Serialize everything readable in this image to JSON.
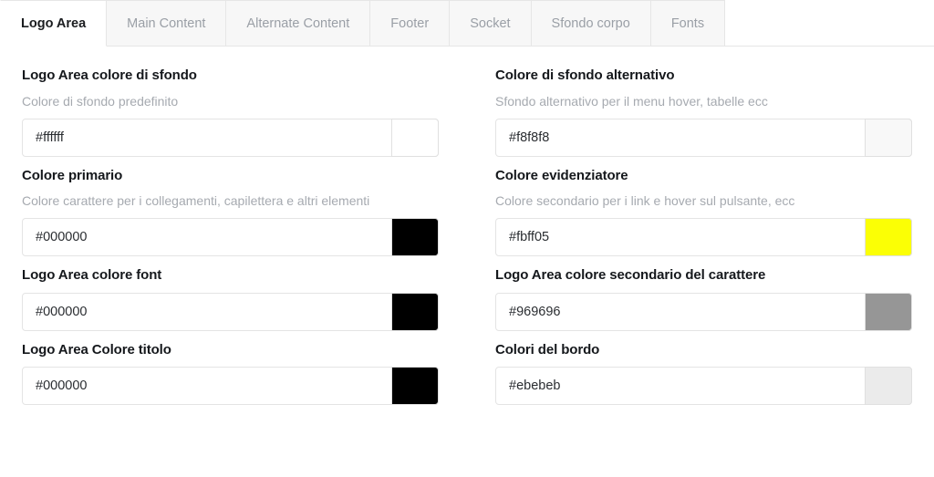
{
  "tabs": [
    {
      "label": "Logo Area",
      "active": true
    },
    {
      "label": "Main Content",
      "active": false
    },
    {
      "label": "Alternate Content",
      "active": false
    },
    {
      "label": "Footer",
      "active": false
    },
    {
      "label": "Socket",
      "active": false
    },
    {
      "label": "Sfondo corpo",
      "active": false
    },
    {
      "label": "Fonts",
      "active": false
    }
  ],
  "left_column": [
    {
      "label": "Logo Area colore di sfondo",
      "description": "Colore di sfondo predefinito",
      "value": "#ffffff",
      "swatch_color": "#ffffff"
    },
    {
      "label": "Colore primario",
      "description": "Colore carattere per i collegamenti, capilettera e altri elementi",
      "value": "#000000",
      "swatch_color": "#000000"
    },
    {
      "label": "Logo Area colore font",
      "description": "",
      "value": "#000000",
      "swatch_color": "#000000"
    },
    {
      "label": "Logo Area Colore titolo",
      "description": "",
      "value": "#000000",
      "swatch_color": "#000000"
    }
  ],
  "right_column": [
    {
      "label": "Colore di sfondo alternativo",
      "description": "Sfondo alternativo per il menu hover, tabelle ecc",
      "value": "#f8f8f8",
      "swatch_color": "#f8f8f8"
    },
    {
      "label": "Colore evidenziatore",
      "description": "Colore secondario per i link e hover sul pulsante, ecc",
      "value": "#fbff05",
      "swatch_color": "#fbff05"
    },
    {
      "label": "Logo Area colore secondario del carattere",
      "description": "",
      "value": "#969696",
      "swatch_color": "#969696"
    },
    {
      "label": "Colori del bordo",
      "description": "",
      "value": "#ebebeb",
      "swatch_color": "#ebebeb"
    }
  ]
}
